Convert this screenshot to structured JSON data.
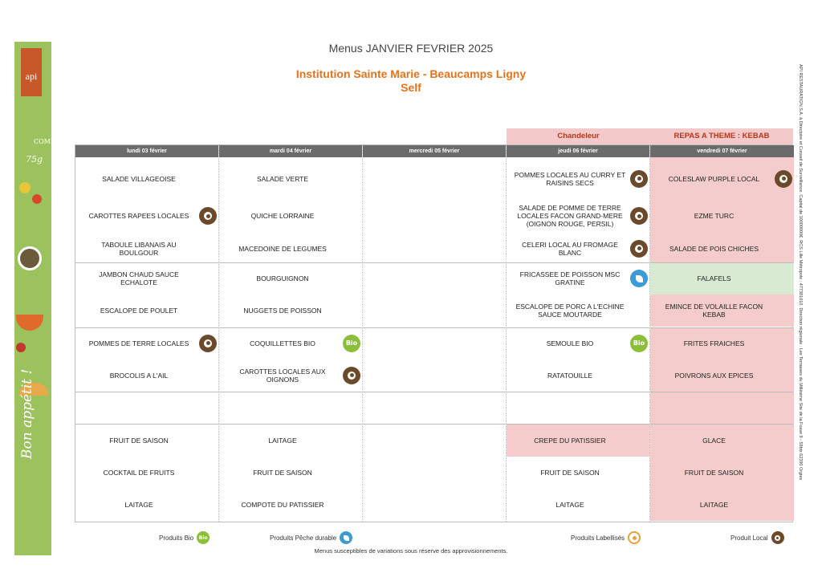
{
  "header": {
    "title": "Menus JANVIER FEVRIER 2025",
    "institution": "Institution Sainte Marie - Beaucamps Ligny",
    "service": "Self"
  },
  "brand": {
    "logo": "api",
    "strip_text": "Bon appétit !",
    "deco_compter": "COMPTER",
    "deco_weight": "75g"
  },
  "legal_text": "API RESTAURATION S.A. à Directoire et Conseil de Surveillance. Capital de 10000000€. RCS Lille Métropole : 477381010. Direction régionale : Les Terrasses du Millésime Site de la Fosse 9 - 59bis 62390 Orgies",
  "events": {
    "thursday": "Chandeleur",
    "friday": "REPAS A THEME : KEBAB"
  },
  "days": [
    "lundi 03 février",
    "mardi 04 février",
    "mercredi 05 février",
    "jeudi 06 février",
    "vendredi 07 février"
  ],
  "menu": {
    "monday": [
      {
        "text": "SALADE VILLAGEOISE"
      },
      {
        "text": "CAROTTES RAPEES LOCALES",
        "badge": "local"
      },
      {
        "text": "TABOULE LIBANAIS AU BOULGOUR"
      },
      {
        "text": "JAMBON CHAUD SAUCE ECHALOTE"
      },
      {
        "text": "ESCALOPE DE POULET"
      },
      {
        "text": "POMMES DE TERRE LOCALES",
        "badge": "local"
      },
      {
        "text": "BROCOLIS A L'AIL"
      },
      {
        "text": ""
      },
      {
        "text": "FRUIT DE SAISON"
      },
      {
        "text": "COCKTAIL DE FRUITS"
      },
      {
        "text": "LAITAGE"
      }
    ],
    "tuesday": [
      {
        "text": "SALADE VERTE"
      },
      {
        "text": "QUICHE LORRAINE"
      },
      {
        "text": "MACEDOINE DE LEGUMES"
      },
      {
        "text": "BOURGUIGNON"
      },
      {
        "text": "NUGGETS DE POISSON"
      },
      {
        "text": "COQUILLETTES BIO",
        "badge": "bio"
      },
      {
        "text": "CAROTTES LOCALES AUX OIGNONS",
        "badge": "local"
      },
      {
        "text": ""
      },
      {
        "text": "LAITAGE"
      },
      {
        "text": "FRUIT DE SAISON"
      },
      {
        "text": "COMPOTE DU PATISSIER"
      }
    ],
    "thursday": [
      {
        "text": "POMMES LOCALES AU CURRY ET RAISINS SECS",
        "badge": "local"
      },
      {
        "text": "SALADE DE POMME DE TERRE LOCALES FACON GRAND-MERE (OIGNON ROUGE, PERSIL)",
        "badge": "local"
      },
      {
        "text": "CELERI LOCAL AU FROMAGE BLANC",
        "badge": "local"
      },
      {
        "text": "FRICASSEE DE POISSON MSC GRATINE",
        "badge": "peche"
      },
      {
        "text": "ESCALOPE DE PORC A L'ECHINE SAUCE MOUTARDE"
      },
      {
        "text": "SEMOULE BIO",
        "badge": "bio"
      },
      {
        "text": "RATATOUILLE"
      },
      {
        "text": ""
      },
      {
        "text": "CREPE DU PATISSIER",
        "style": "pink"
      },
      {
        "text": "FRUIT DE SAISON"
      },
      {
        "text": "LAITAGE"
      }
    ],
    "friday": [
      {
        "text": "COLESLAW PURPLE LOCAL",
        "badge": "local",
        "style": "pink"
      },
      {
        "text": "EZME TURC",
        "style": "pink"
      },
      {
        "text": "SALADE DE POIS CHICHES",
        "style": "pink"
      },
      {
        "text": "FALAFELS",
        "style": "green"
      },
      {
        "text": "EMINCE DE VOLAILLE FACON KEBAB",
        "style": "pink"
      },
      {
        "text": "FRITES FRAICHES",
        "style": "pink"
      },
      {
        "text": "POIVRONS AUX EPICES",
        "style": "pink"
      },
      {
        "text": "",
        "style": "pink"
      },
      {
        "text": "GLACE",
        "style": "pink"
      },
      {
        "text": "FRUIT DE SAISON",
        "style": "pink"
      },
      {
        "text": "LAITAGE",
        "style": "pink"
      }
    ]
  },
  "badge_text": {
    "bio": "Bio"
  },
  "legend": {
    "bio": "Produits Bio",
    "peche": "Produits Pêche durable",
    "label": "Produits Labellisés",
    "local": "Produit Local"
  },
  "footnote": "Menus susceptibles de variations sous réserve des approvisionnements.",
  "colors": {
    "orange": "#e4731c",
    "header_gray": "#6b6b6b",
    "pink": "#f4cccc",
    "green_cell": "#d9ead3",
    "strip_green": "#9cc25d",
    "local_brown": "#6b4a2c",
    "bio_green": "#8bbf3a",
    "peche_blue": "#3b9bd6"
  }
}
